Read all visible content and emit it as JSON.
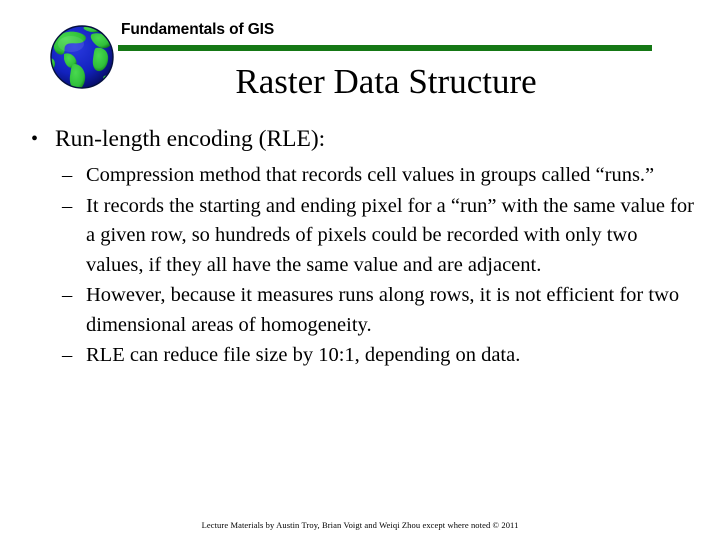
{
  "slide": {
    "course_title": "Fundamentals of GIS",
    "title": "Raster Data Structure",
    "logo_icon": "globe-icon",
    "accent_color": "#157815",
    "background_color": "#FFFFFF",
    "text_color": "#000000",
    "globe_ocean_color": "#1222BE",
    "globe_land_color": "#2FBF3A",
    "bullets": [
      {
        "marker": "•",
        "text": "Run-length encoding (RLE):",
        "children": [
          {
            "marker": "–",
            "text": "Compression method that records cell values in groups called “runs.”"
          },
          {
            "marker": "–",
            "text": "It records the starting and ending pixel for a “run” with the same value for a given row, so hundreds of pixels could be recorded with only two values, if they all have the same value and are adjacent."
          },
          {
            "marker": "–",
            "text": "However, because it measures runs along rows, it is not efficient for two dimensional areas of homogeneity."
          },
          {
            "marker": "–",
            "text": "RLE can reduce file size by 10:1, depending on data."
          }
        ]
      }
    ],
    "footer": "Lecture Materials by Austin Troy, Brian Voigt and Weiqi Zhou except where noted © 2011"
  }
}
